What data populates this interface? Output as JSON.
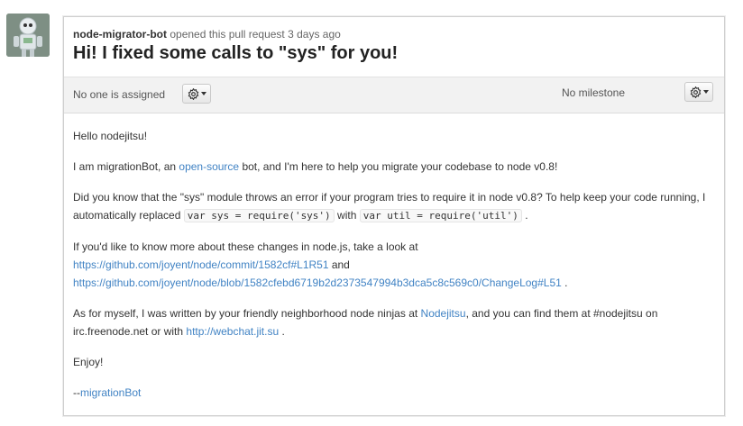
{
  "avatar": {
    "alt": "node-migrator-bot avatar"
  },
  "header": {
    "author": "node-migrator-bot",
    "action": "opened this pull request 3 days ago",
    "title": "Hi! I fixed some calls to \"sys\" for you!"
  },
  "infobar": {
    "assignee": "No one is assigned",
    "milestone": "No milestone"
  },
  "body": {
    "greeting": "Hello nodejitsu!",
    "p1_a": "I am migrationBot, an ",
    "p1_link": "open-source",
    "p1_b": " bot, and I'm here to help you migrate your codebase to node v0.8!",
    "p2_a": "Did you know that the \"sys\" module throws an error if your program tries to require it in node v0.8? To help keep your code running, I automatically replaced ",
    "p2_code1": "var sys = require('sys')",
    "p2_mid": " with ",
    "p2_code2": "var util = require('util')",
    "p2_end": " .",
    "p3_a": "If you'd like to know more about these changes in node.js, take a look at",
    "p3_link1": "https://github.com/joyent/node/commit/1582cf#L1R51",
    "p3_and": " and",
    "p3_link2": "https://github.com/joyent/node/blob/1582cfebd6719b2d2373547994b3dca5c8c569c0/ChangeLog#L51",
    "p3_end": " .",
    "p4_a": "As for myself, I was written by your friendly neighborhood node ninjas at ",
    "p4_link1": "Nodejitsu",
    "p4_b": ", and you can find them at #nodejitsu on irc.freenode.net or with ",
    "p4_link2": "http://webchat.jit.su",
    "p4_end": " .",
    "enjoy": "Enjoy!",
    "signature": "--migrationBot"
  }
}
